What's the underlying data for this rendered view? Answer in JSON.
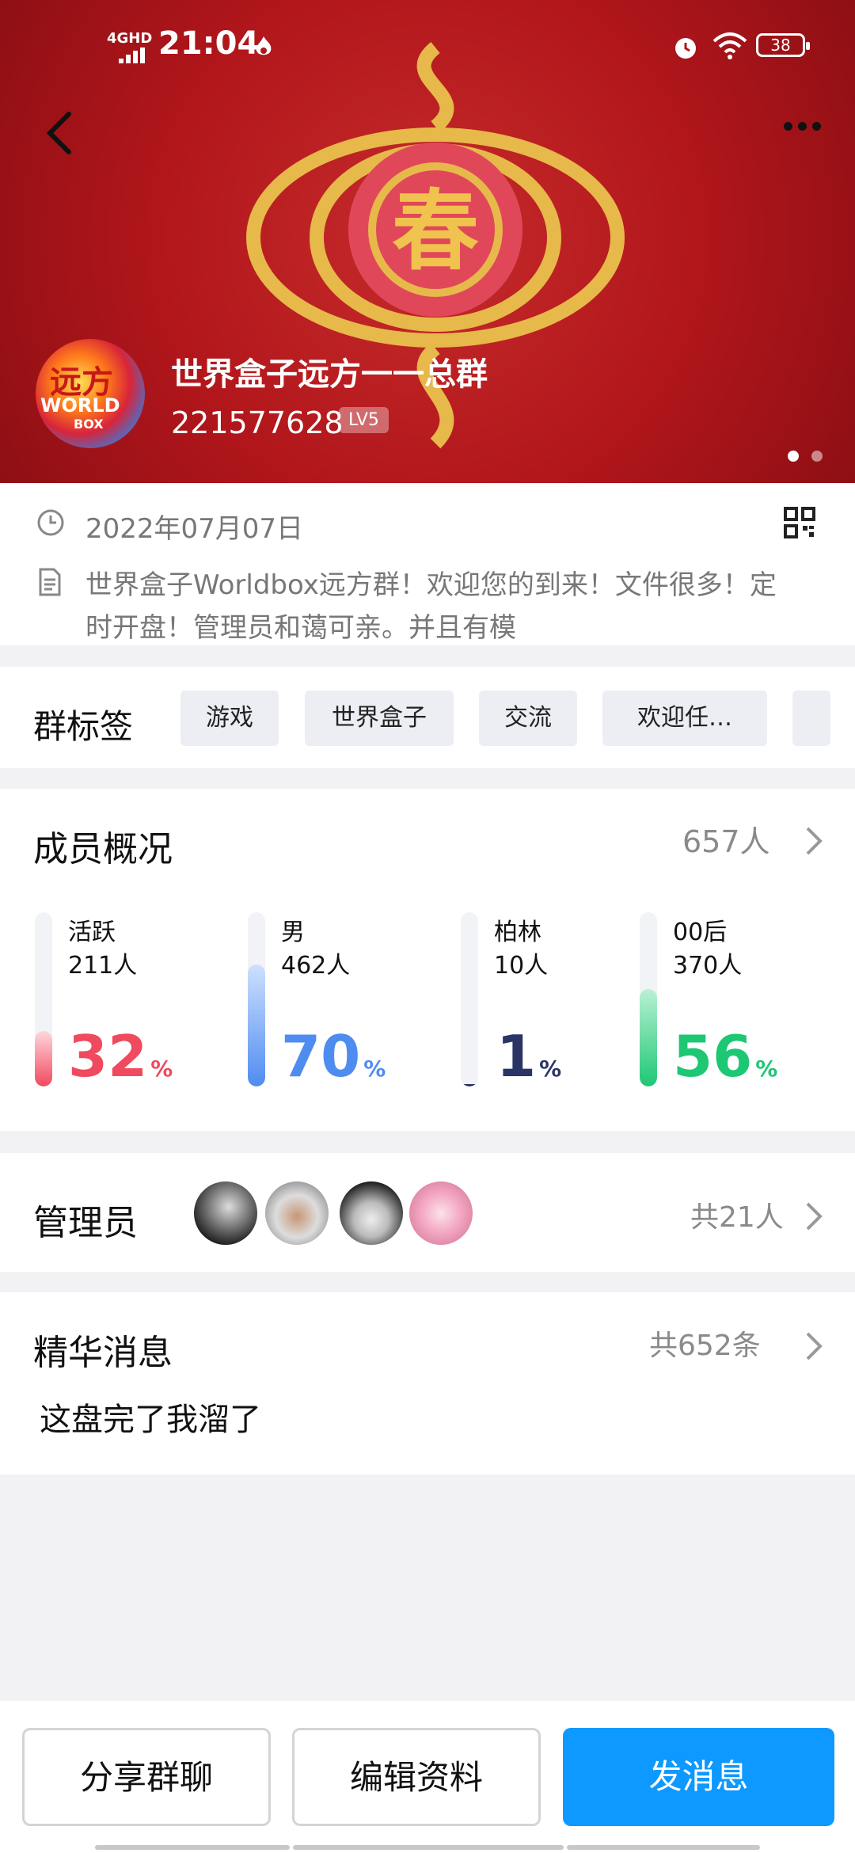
{
  "status_bar": {
    "time": "21:04",
    "network": "4GHD",
    "battery": "38"
  },
  "group": {
    "name": "世界盒子远方一一总群",
    "id": "221577628",
    "level": "LV5",
    "avatar_text_1": "远方",
    "avatar_text_2": "WORLD",
    "avatar_text_3": "BOX",
    "created_date": "2022年07月07日",
    "description": "世界盒子Worldbox远方群！欢迎您的到来！文件很多！定时开盘！管理员和蔼可亲。并且有模"
  },
  "tags_section": {
    "title": "群标签",
    "tags": [
      "游戏",
      "世界盒子",
      "交流",
      "欢迎任…"
    ]
  },
  "members": {
    "title": "成员概况",
    "total": "657人",
    "stats": [
      {
        "label": "活跃",
        "count": "211人",
        "percent": "32",
        "unit": "%",
        "value": 0.32,
        "color": "#f04a5e",
        "fill_top": "#ffd6dc"
      },
      {
        "label": "男",
        "count": "462人",
        "percent": "70",
        "unit": "%",
        "value": 0.7,
        "color": "#4f8cf0",
        "fill_top": "#cfe0ff"
      },
      {
        "label": "柏林",
        "count": "10人",
        "percent": "1",
        "unit": "%",
        "value": 0.01,
        "color": "#2a3566",
        "fill_top": "#2a3566"
      },
      {
        "label": "00后",
        "count": "370人",
        "percent": "56",
        "unit": "%",
        "value": 0.56,
        "color": "#1ec774",
        "fill_top": "#b9f1d4"
      }
    ]
  },
  "admins": {
    "title": "管理员",
    "count": "共21人"
  },
  "featured": {
    "title": "精华消息",
    "count": "共652条",
    "latest": "这盘完了我溜了"
  },
  "actions": {
    "share": "分享群聊",
    "edit": "编辑资料",
    "send": "发消息"
  },
  "colors": {
    "header_red": "#b1161b",
    "gold": "#e7b84a",
    "primary_blue": "#0d99ff"
  }
}
